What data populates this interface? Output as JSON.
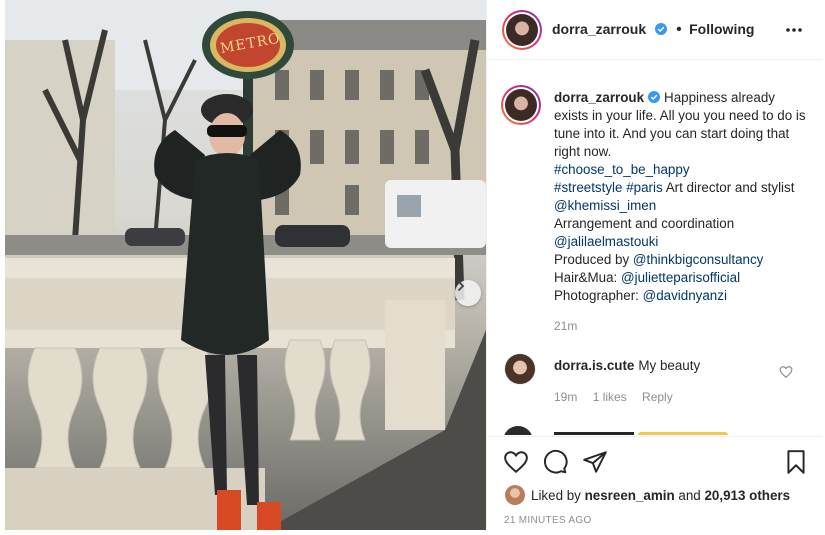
{
  "photo": {
    "sign_text": "METRO"
  },
  "post": {
    "author": "dorra_zarrouk",
    "separator": "•",
    "follow_state": "Following"
  },
  "caption": {
    "username": "dorra_zarrouk",
    "line1": "Happiness already exists in your life. All you you need to do is tune into it. And you can start doing that right now.",
    "tag1": "#choose_to_be_happy",
    "tag2": "#streetstyle",
    "tag3": "#paris",
    "text2": "Art director and stylist",
    "mention1": "@khemissi_imen",
    "text3": "Arrangement and coordination",
    "mention2": "@jalilaelmastouki",
    "text4": "Produced by",
    "mention3": "@thinkbigconsultancy",
    "text5": "Hair&Mua:",
    "mention4": "@julietteparisofficial",
    "text6": "Photographer:",
    "mention5": "@davidnyanzi",
    "time": "21m"
  },
  "comment": {
    "username": "dorra.is.cute",
    "text": "My beauty",
    "time": "19m",
    "likes": "1 likes",
    "reply": "Reply"
  },
  "likes": {
    "prefix": "Liked by",
    "user": "nesreen_amin",
    "middle": "and",
    "count": "20,913 others"
  },
  "timestamp": "21 MINUTES AGO",
  "colors": {
    "link": "#00376b",
    "verified": "#3897f0",
    "muted": "#8e8e8e",
    "text": "#262626"
  },
  "icons": [
    "verified-badge-icon",
    "more-options-icon",
    "heart-icon",
    "comment-icon",
    "share-icon",
    "bookmark-icon",
    "chevron-right-icon"
  ]
}
